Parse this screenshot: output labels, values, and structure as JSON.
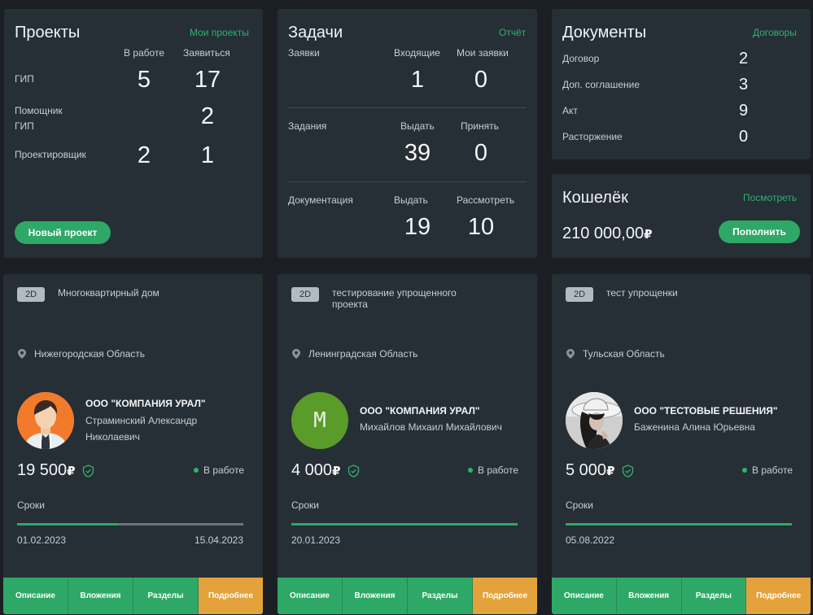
{
  "projects": {
    "title": "Проекты",
    "link": "Мои проекты",
    "col1": "В работе",
    "col2": "Заявиться",
    "rows": [
      {
        "label": "ГИП",
        "v1": "5",
        "v2": "17"
      },
      {
        "label": "Помощник ГИП",
        "v1": "",
        "v2": "2"
      },
      {
        "label": "Проектировщик",
        "v1": "2",
        "v2": "1"
      }
    ],
    "new_button": "Новый проект"
  },
  "tasks": {
    "title": "Задачи",
    "link": "Отчёт",
    "sections": [
      {
        "label": "Заявки",
        "c1": "Входящие",
        "c2": "Мои заявки",
        "v1": "1",
        "v2": "0"
      },
      {
        "label": "Задания",
        "c1": "Выдать",
        "c2": "Принять",
        "v1": "39",
        "v2": "0"
      },
      {
        "label": "Документация",
        "c1": "Выдать",
        "c2": "Рассмотреть",
        "v1": "19",
        "v2": "10"
      }
    ]
  },
  "documents": {
    "title": "Документы",
    "link": "Договоры",
    "rows": [
      {
        "label": "Договор",
        "value": "2"
      },
      {
        "label": "Доп. соглашение",
        "value": "3"
      },
      {
        "label": "Акт",
        "value": "9"
      },
      {
        "label": "Расторжение",
        "value": "0"
      }
    ]
  },
  "wallet": {
    "title": "Кошелёк",
    "link": "Посмотреть",
    "amount": "210 000,00",
    "currency": "₽",
    "button": "Пополнить"
  },
  "cards": [
    {
      "tag": "2D",
      "title": "Многоквартирный дом",
      "region": "Нижегородская Область",
      "company": "ООО \"КОМПАНИЯ УРАЛ\"",
      "person": "Страминский Александр Николаевич",
      "price": "19 500",
      "currency": "₽",
      "status": "В работе",
      "deadline_label": "Сроки",
      "progress": 0.45,
      "date_start": "01.02.2023",
      "date_end": "15.04.2023",
      "avatar": "man-avatar-icon",
      "tabs": [
        "Описание",
        "Вложения",
        "Разделы",
        "Подробнее"
      ]
    },
    {
      "tag": "2D",
      "title": "тестирование упрощенного проекта",
      "region": "Ленинградская Область",
      "company": "ООО \"КОМПАНИЯ УРАЛ\"",
      "person": "Михайлов Михаил Михайлович",
      "price": "4 000",
      "currency": "₽",
      "status": "В работе",
      "deadline_label": "Сроки",
      "progress": 1.0,
      "date_start": "20.01.2023",
      "date_end": "",
      "avatar_letter": "М",
      "tabs": [
        "Описание",
        "Вложения",
        "Разделы",
        "Подробнее"
      ]
    },
    {
      "tag": "2D",
      "title": "тест упрощенки",
      "region": "Тульская Область",
      "company": "ООО \"ТЕСТОВЫЕ РЕШЕНИЯ\"",
      "person": "Баженина Алина Юрьевна",
      "price": "5 000",
      "currency": "₽",
      "status": "В работе",
      "deadline_label": "Сроки",
      "progress": 1.0,
      "date_start": "05.08.2022",
      "date_end": "",
      "avatar": "woman-photo-avatar",
      "tabs": [
        "Описание",
        "Вложения",
        "Разделы",
        "Подробнее"
      ]
    }
  ],
  "colors": {
    "accent": "#2ea866",
    "orange": "#e3a23b",
    "panel": "#262e36",
    "background": "#1b1f23"
  }
}
